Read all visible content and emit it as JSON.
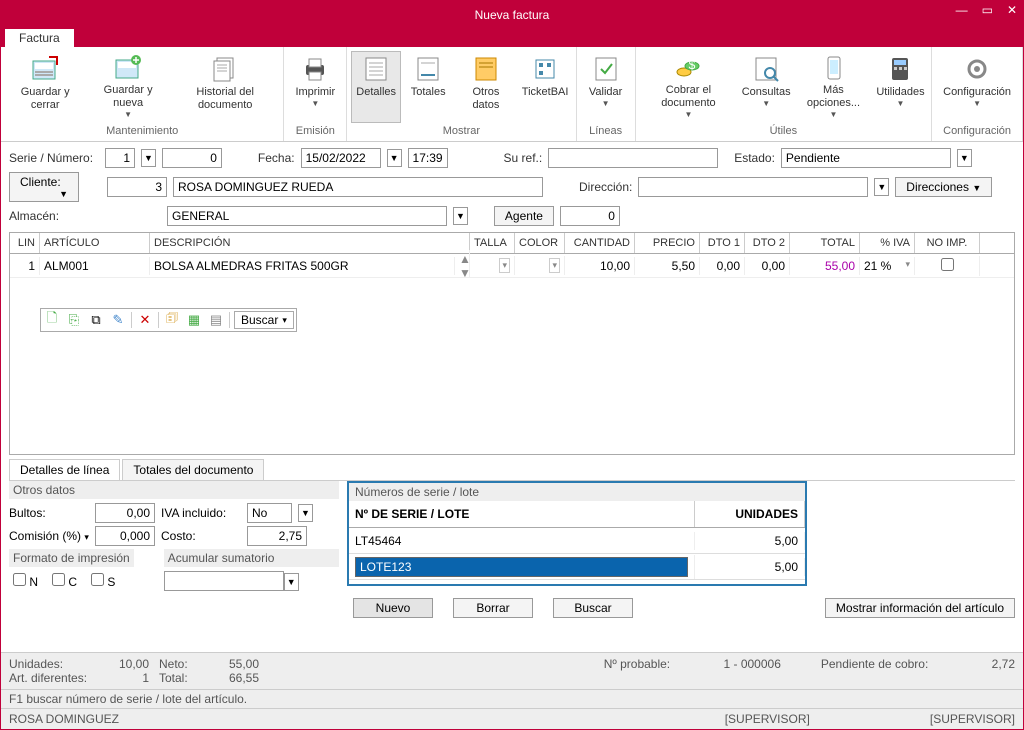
{
  "window": {
    "title": "Nueva factura"
  },
  "tab": {
    "label": "Factura"
  },
  "ribbon": {
    "groups": [
      {
        "label": "Mantenimiento",
        "items": [
          {
            "name": "guardar-cerrar",
            "label": "Guardar y cerrar"
          },
          {
            "name": "guardar-nueva",
            "label": "Guardar y nueva",
            "dd": true
          },
          {
            "name": "historial",
            "label": "Historial del documento"
          }
        ]
      },
      {
        "label": "Emisión",
        "items": [
          {
            "name": "imprimir",
            "label": "Imprimir",
            "dd": true
          }
        ]
      },
      {
        "label": "Mostrar",
        "items": [
          {
            "name": "detalles",
            "label": "Detalles",
            "active": true
          },
          {
            "name": "totales",
            "label": "Totales"
          },
          {
            "name": "otros-datos",
            "label": "Otros datos"
          },
          {
            "name": "ticketbai",
            "label": "TicketBAI"
          }
        ]
      },
      {
        "label": "Líneas",
        "items": [
          {
            "name": "validar",
            "label": "Validar",
            "dd": true
          }
        ]
      },
      {
        "label": "Útiles",
        "items": [
          {
            "name": "cobrar",
            "label": "Cobrar el documento",
            "dd": true
          },
          {
            "name": "consultas",
            "label": "Consultas",
            "dd": true
          },
          {
            "name": "mas-opciones",
            "label": "Más opciones...",
            "dd": true
          },
          {
            "name": "utilidades",
            "label": "Utilidades",
            "dd": true
          }
        ]
      },
      {
        "label": "Configuración",
        "items": [
          {
            "name": "configuracion",
            "label": "Configuración",
            "dd": true
          }
        ]
      }
    ]
  },
  "form": {
    "serie_label": "Serie / Número:",
    "serie": "1",
    "numero": "0",
    "fecha_label": "Fecha:",
    "fecha": "15/02/2022",
    "hora": "17:39",
    "suref_label": "Su ref.:",
    "suref": "",
    "estado_label": "Estado:",
    "estado": "Pendiente",
    "cliente_label": "Cliente:",
    "cliente_num": "3",
    "cliente_nom": "ROSA DOMINGUEZ RUEDA",
    "direccion_label": "Dirección:",
    "direcciones_btn": "Direcciones",
    "almacen_label": "Almacén:",
    "almacen": "GENERAL",
    "agente_btn": "Agente",
    "agente_val": "0"
  },
  "grid": {
    "headers": [
      "LIN",
      "ARTÍCULO",
      "DESCRIPCIÓN",
      "TALLA",
      "COLOR",
      "CANTIDAD",
      "PRECIO",
      "DTO 1",
      "DTO 2",
      "TOTAL",
      "% IVA",
      "NO IMP."
    ],
    "rows": [
      {
        "lin": "1",
        "articulo": "ALM001",
        "desc": "BOLSA ALMEDRAS FRITAS 500GR",
        "talla": "",
        "color": "",
        "cantidad": "10,00",
        "precio": "5,50",
        "dto1": "0,00",
        "dto2": "0,00",
        "total": "55,00",
        "iva": "21 %",
        "noimp": false
      }
    ],
    "toolbar_buscar": "Buscar"
  },
  "detail_tabs": {
    "linea": "Detalles de línea",
    "totales": "Totales del documento"
  },
  "otros": {
    "title": "Otros datos",
    "bultos_label": "Bultos:",
    "bultos": "0,00",
    "iva_label": "IVA incluido:",
    "iva": "No",
    "comision_label": "Comisión (%)",
    "comision": "0,000",
    "costo_label": "Costo:",
    "costo": "2,75",
    "formato_title": "Formato de impresión",
    "acumular_title": "Acumular sumatorio",
    "n": "N",
    "c": "C",
    "s": "S"
  },
  "serie": {
    "title": "Números de serie / lote",
    "col_serie": "Nº DE SERIE / LOTE",
    "col_unidades": "UNIDADES",
    "rows": [
      {
        "lote": "LT45464",
        "unidades": "5,00"
      },
      {
        "lote": "LOTE123",
        "unidades": "5,00",
        "editing": true
      }
    ],
    "nuevo": "Nuevo",
    "borrar": "Borrar",
    "buscar": "Buscar"
  },
  "info_btn": "Mostrar información del artículo",
  "footer": {
    "unidades_label": "Unidades:",
    "unidades": "10,00",
    "neto_label": "Neto:",
    "neto": "55,00",
    "art_label": "Art. diferentes:",
    "art": "1",
    "total_label": "Total:",
    "total": "66,55",
    "probable_label": "Nº probable:",
    "probable": "1 - 000006",
    "pendiente_label": "Pendiente de cobro:",
    "pendiente": "2,72",
    "hint": "F1 buscar número de serie / lote del artículo."
  },
  "status": {
    "user": "ROSA DOMINGUEZ",
    "sup1": "[SUPERVISOR]",
    "sup2": "[SUPERVISOR]"
  }
}
